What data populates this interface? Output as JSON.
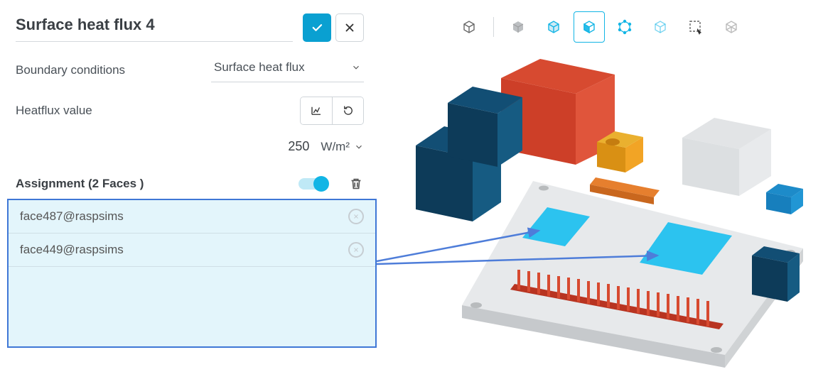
{
  "panel": {
    "title": "Surface heat flux 4",
    "confirm_aria": "✓",
    "close_aria": "✕"
  },
  "boundary": {
    "label": "Boundary conditions",
    "value": "Surface heat flux"
  },
  "heatflux": {
    "label": "Heatflux value",
    "value": "250",
    "unit": "W/m²"
  },
  "assignment": {
    "label": "Assignment (2 Faces )",
    "items": [
      {
        "name": "face487@raspsims"
      },
      {
        "name": "face449@raspsims"
      }
    ]
  },
  "viewmodes": [
    {
      "id": "wireframe-cube-icon",
      "active": false
    },
    {
      "id": "solid-cube-icon",
      "active": false
    },
    {
      "id": "edges-cube-icon",
      "active": false
    },
    {
      "id": "front-face-cube-icon",
      "active": true
    },
    {
      "id": "vertices-cube-icon",
      "active": false
    },
    {
      "id": "transparent-cube-icon",
      "active": false
    },
    {
      "id": "select-box-icon",
      "active": false
    },
    {
      "id": "bounding-cube-icon",
      "active": false
    }
  ],
  "colors": {
    "accent": "#0aa0d1",
    "highlight": "#12b5e5",
    "select": "#3f77d6",
    "pcb": "#d8dbdd",
    "red": "#d74a30",
    "darkblue": "#124e74",
    "midblue": "#0aa0d1",
    "orange": "#f2a425",
    "orange2": "#e67f2e",
    "grey": "#e0e3e5",
    "cyan": "#2cc3ef"
  }
}
